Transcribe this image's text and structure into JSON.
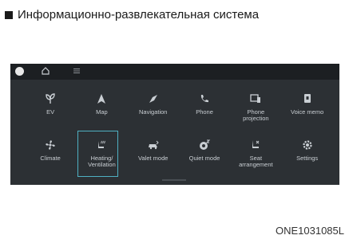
{
  "header": {
    "title": "Информационно-развлекательная система"
  },
  "status_bar": {
    "icons": [
      "profile-icon",
      "home-icon",
      "menu-icon"
    ]
  },
  "tiles": [
    {
      "label": "EV",
      "icon": "ev-leaf-icon"
    },
    {
      "label": "Map",
      "icon": "map-arrow-icon"
    },
    {
      "label": "Navigation",
      "icon": "navigation-compass-icon"
    },
    {
      "label": "Phone",
      "icon": "phone-icon"
    },
    {
      "label": "Phone\nprojection",
      "icon": "phone-projection-icon"
    },
    {
      "label": "Voice memo",
      "icon": "voice-memo-icon"
    },
    {
      "label": "Climate",
      "icon": "climate-fan-icon"
    },
    {
      "label": "Heating/\nVentilation",
      "icon": "seat-heating-icon",
      "selected": true
    },
    {
      "label": "Valet mode",
      "icon": "valet-mode-icon"
    },
    {
      "label": "Quiet mode",
      "icon": "quiet-mode-icon"
    },
    {
      "label": "Seat\narrangement",
      "icon": "seat-arrangement-icon"
    },
    {
      "label": "Settings",
      "icon": "settings-gear-icon"
    }
  ],
  "colors": {
    "screen": "#2c3034",
    "highlight": "#4fb0c2",
    "icon": "#c9ced3"
  },
  "figure_code": "ONE1031085L"
}
